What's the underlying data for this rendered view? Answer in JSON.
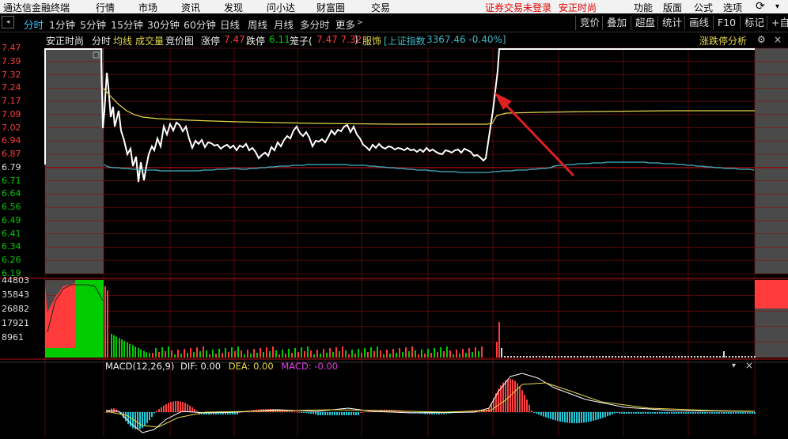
{
  "menubar": {
    "app_title": "通达信金融终端",
    "items": [
      "行情",
      "市场",
      "资讯",
      "发现",
      "问小达",
      "财富圈",
      "交易"
    ],
    "login_status": "证券交易未登录",
    "stock_name": "安正时尚",
    "right_items": [
      "功能",
      "版面",
      "公式",
      "选项"
    ]
  },
  "toolbar": {
    "tabs": [
      "分时",
      "1分钟",
      "5分钟",
      "15分钟",
      "30分钟",
      "60分钟",
      "日线",
      "周线",
      "月线",
      "多分时",
      "更多"
    ],
    "selected": "分时",
    "right_buttons": [
      "竞价",
      "叠加",
      "超盘",
      "统计",
      "画线",
      "F10",
      "标记",
      "+自选"
    ]
  },
  "infobar": {
    "stock": "安正时尚",
    "mode": "分时",
    "avg_line": "均线",
    "volume": "成交量",
    "auction": "竞价图",
    "limit_up_label": "涨停",
    "limit_up_value": "7.47",
    "limit_down_label": "跌停",
    "limit_down_value": "6.11",
    "cage_label": "笼子(",
    "cage_values": "7.47 7.32",
    "cage_close": ")",
    "sector": "服饰",
    "index_label": "[上证指数",
    "index_value": "3367.46 -0.40%]",
    "analysis": "涨跌停分析"
  },
  "price_axis": {
    "labels": [
      "7.47",
      "7.39",
      "7.32",
      "7.24",
      "7.17",
      "7.09",
      "7.02",
      "6.94",
      "6.87",
      "6.79",
      "6.71",
      "6.64",
      "6.56",
      "6.49",
      "6.41",
      "6.34",
      "6.26",
      "6.19"
    ],
    "colors": {
      "up": "#ff3b3b",
      "flat": "#dddddd",
      "down": "#00cc00"
    }
  },
  "volume_axis": {
    "labels": [
      "44803",
      "35843",
      "26882",
      "17921",
      "8961"
    ]
  },
  "macd": {
    "title": "MACD(12,26,9)",
    "dif": "DIF: 0.00",
    "dea": "DEA: 0.00",
    "macd": "MACD: -0.00"
  },
  "colors": {
    "price_line": "#ffffff",
    "avg_line": "#e6d84a",
    "index_line": "#3fb8c8",
    "up": "#ff3b3b",
    "down": "#00cc00",
    "grid": "#8a1010",
    "macd_dif": "#ffffff",
    "macd_dea": "#e6d84a",
    "macd_pos": "#ff4040",
    "macd_neg": "#21c6d6",
    "arrow": "#e02020"
  }
}
